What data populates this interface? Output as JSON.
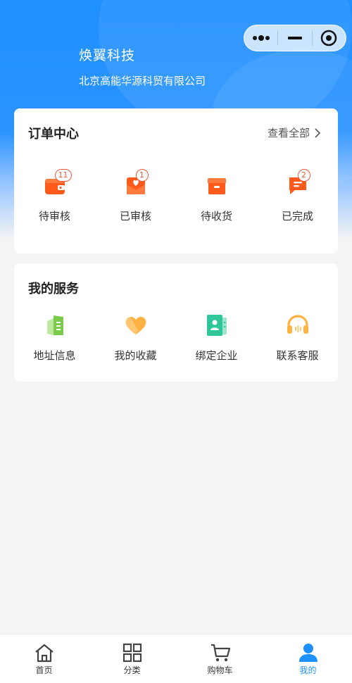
{
  "header": {
    "company_name": "焕翼科技",
    "company_subtitle": "北京高能华源科贸有限公司"
  },
  "capsule": {
    "more_icon": "more-dots-icon",
    "minimize_icon": "minimize-icon",
    "close_icon": "target-close-icon"
  },
  "orders": {
    "title": "订单中心",
    "view_all": "查看全部",
    "items": [
      {
        "label": "待审核",
        "badge": "11",
        "icon": "wallet-icon"
      },
      {
        "label": "已审核",
        "badge": "1",
        "icon": "heart-envelope-icon"
      },
      {
        "label": "待收货",
        "badge": "",
        "icon": "box-icon"
      },
      {
        "label": "已完成",
        "badge": "2",
        "icon": "message-icon"
      }
    ]
  },
  "services": {
    "title": "我的服务",
    "items": [
      {
        "label": "地址信息",
        "icon": "address-book-icon"
      },
      {
        "label": "我的收藏",
        "icon": "heart-icon"
      },
      {
        "label": "绑定企业",
        "icon": "enterprise-contact-icon"
      },
      {
        "label": "联系客服",
        "icon": "headset-icon"
      }
    ]
  },
  "tabbar": {
    "items": [
      {
        "label": "首页",
        "icon": "home-icon"
      },
      {
        "label": "分类",
        "icon": "grid-icon"
      },
      {
        "label": "购物车",
        "icon": "cart-icon"
      },
      {
        "label": "我的",
        "icon": "user-icon",
        "active": true
      }
    ]
  },
  "colors": {
    "primary": "#1e90ff",
    "order_icon": "#ff5a1a",
    "badge": "#f05a3c",
    "service_green": "#7ccb4d",
    "service_orange": "#ffb142",
    "service_teal": "#2fc79a"
  }
}
